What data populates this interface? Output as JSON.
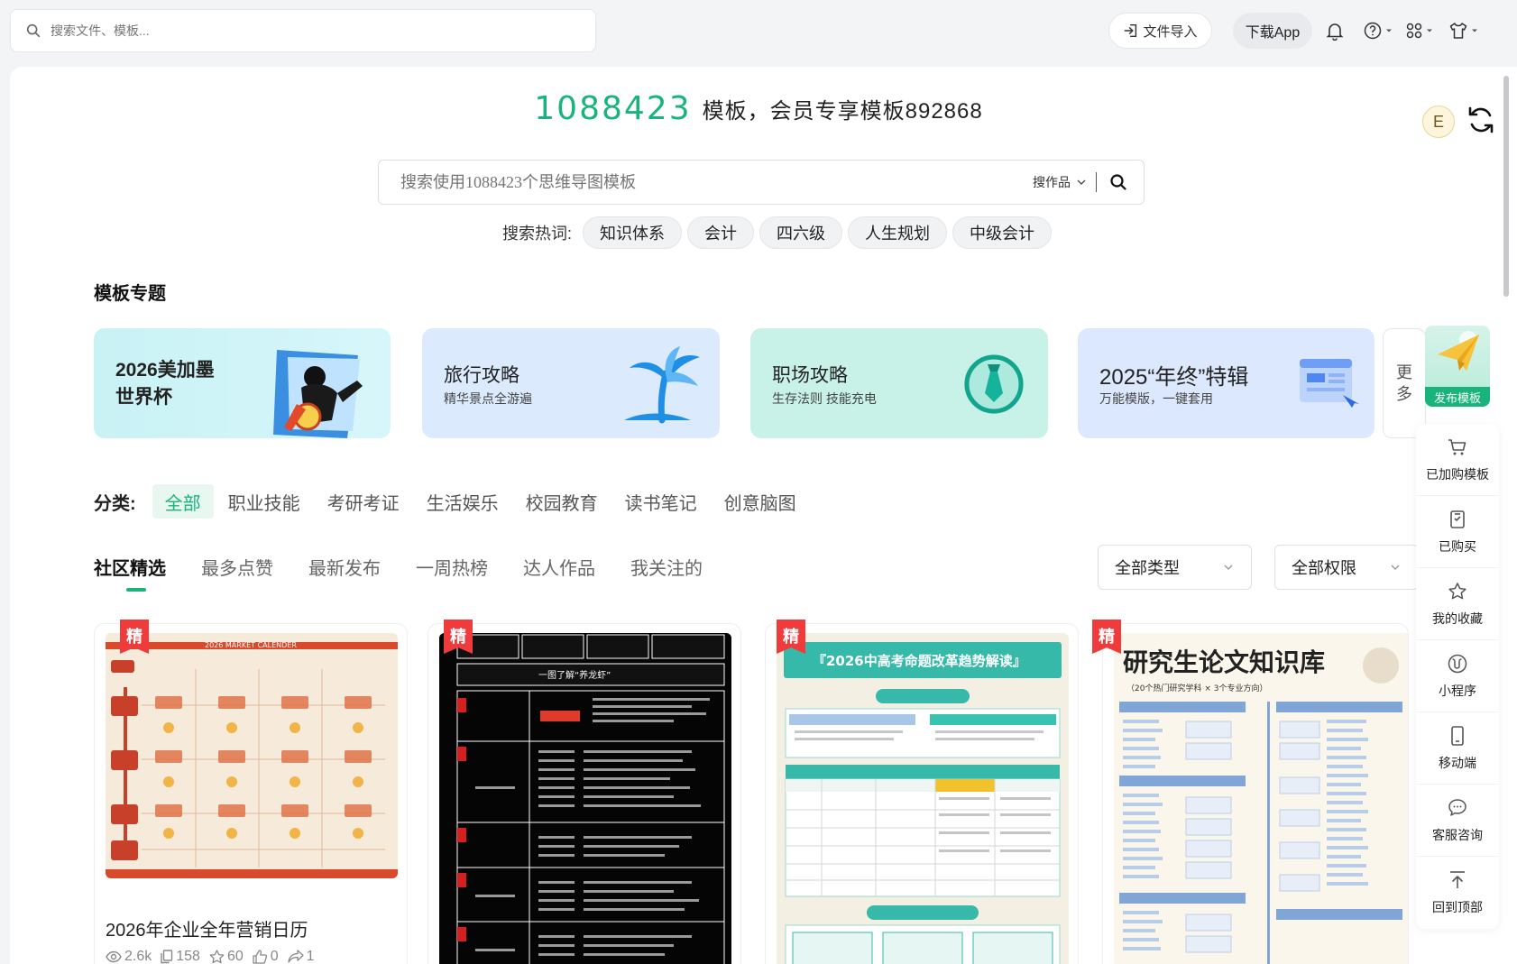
{
  "topbar": {
    "search_placeholder": "搜索文件、模板...",
    "import_label": "文件导入",
    "download_app_label": "下载App"
  },
  "header": {
    "template_count": "1088423",
    "count_text": "模板，会员专享模板892868",
    "avatar_letter": "E"
  },
  "main_search": {
    "placeholder": "搜索使用1088423个思维导图模板",
    "scope_label": "搜作品"
  },
  "hot_words": {
    "label": "搜索热词:",
    "items": [
      "知识体系",
      "会计",
      "四六级",
      "人生规划",
      "中级会计"
    ]
  },
  "topics": {
    "section_title": "模板专题",
    "cards": [
      {
        "title_line1": "2026美加墨",
        "title_line2": "世界杯",
        "subtitle": "",
        "color": "#c9f2f5"
      },
      {
        "title_line1": "旅行攻略",
        "title_line2": "",
        "subtitle": "精华景点全游遍",
        "color": "#dbeafd"
      },
      {
        "title_line1": "职场攻略",
        "title_line2": "",
        "subtitle": "生存法则 技能充电",
        "color": "#c8f2e8"
      },
      {
        "title_line1": "2025“年终”特辑",
        "title_line2": "",
        "subtitle": "万能模版，一键套用",
        "color": "#dbe8fd"
      }
    ],
    "more_label_1": "更",
    "more_label_2": "多"
  },
  "categories": {
    "label": "分类:",
    "items": [
      "全部",
      "职业技能",
      "考研考证",
      "生活娱乐",
      "校园教育",
      "读书笔记",
      "创意脑图"
    ],
    "active": "全部"
  },
  "tabs": {
    "items": [
      "社区精选",
      "最多点赞",
      "最新发布",
      "一周热榜",
      "达人作品",
      "我关注的"
    ],
    "active": "社区精选"
  },
  "filters": {
    "type_label": "全部类型",
    "permission_label": "全部权限"
  },
  "badge_label": "精",
  "cards": [
    {
      "title": "2026年企业全年营销日历",
      "views": "2.6k",
      "copies": "158",
      "stars": "60",
      "likes": "0",
      "shares": "1",
      "thumb_header": "2026 MARKET CALENDER"
    },
    {
      "title": "",
      "thumb_header": "一图了解“养龙虾”"
    },
    {
      "title": "",
      "thumb_header": "『2026中高考命题改革趋势解读』"
    },
    {
      "title": "",
      "thumb_header": "研究生论文知识库",
      "thumb_sub": "（20个热门研究学科 × 3个专业方向）"
    }
  ],
  "rail": {
    "publish_label": "发布模板",
    "items": [
      "已加购模板",
      "已购买",
      "我的收藏",
      "小程序",
      "移动端",
      "客服咨询",
      "回到顶部"
    ]
  },
  "colors": {
    "accent": "#18b47b",
    "badge": "#ef3b3b"
  }
}
